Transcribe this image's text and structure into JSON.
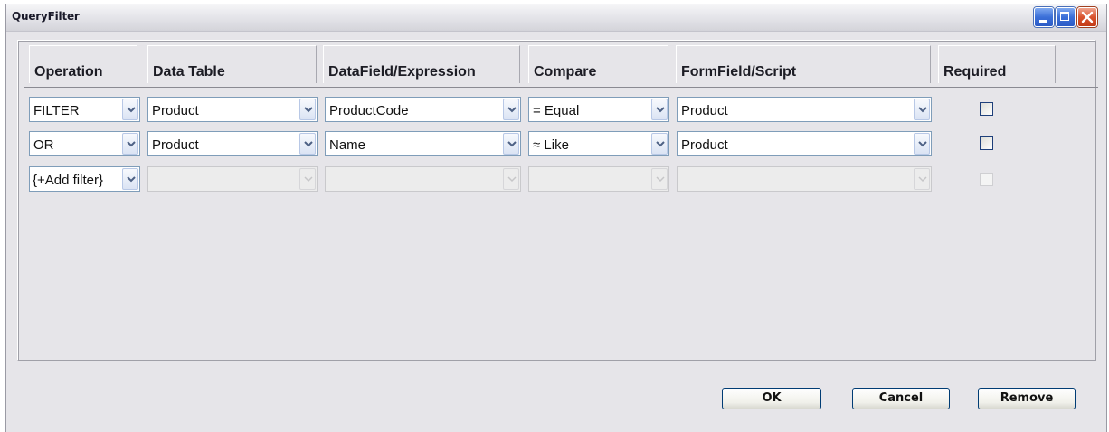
{
  "window": {
    "title": "QueryFilter"
  },
  "columns": [
    "Operation",
    "Data Table",
    "DataField/Expression",
    "Compare",
    "FormField/Script",
    "Required"
  ],
  "rows": [
    {
      "operation": "FILTER",
      "data_table": "Product",
      "data_field": "ProductCode",
      "compare": "= Equal",
      "form_field": "Product",
      "required": false,
      "enabled": true
    },
    {
      "operation": "OR",
      "data_table": "Product",
      "data_field": "Name",
      "compare": "≈ Like",
      "form_field": "Product",
      "required": false,
      "enabled": true
    },
    {
      "operation": "{+Add filter}",
      "data_table": "",
      "data_field": "",
      "compare": "",
      "form_field": "",
      "required": false,
      "enabled": false
    }
  ],
  "buttons": {
    "ok": "OK",
    "cancel": "Cancel",
    "remove": "Remove"
  },
  "colors": {
    "accent": "#3b6fd8",
    "close": "#d9532e",
    "dialog_bg": "#e6e5e9"
  },
  "icons": {
    "minimize": "minimize-icon",
    "maximize": "maximize-icon",
    "close": "close-icon",
    "dropdown": "chevron-down-icon"
  }
}
